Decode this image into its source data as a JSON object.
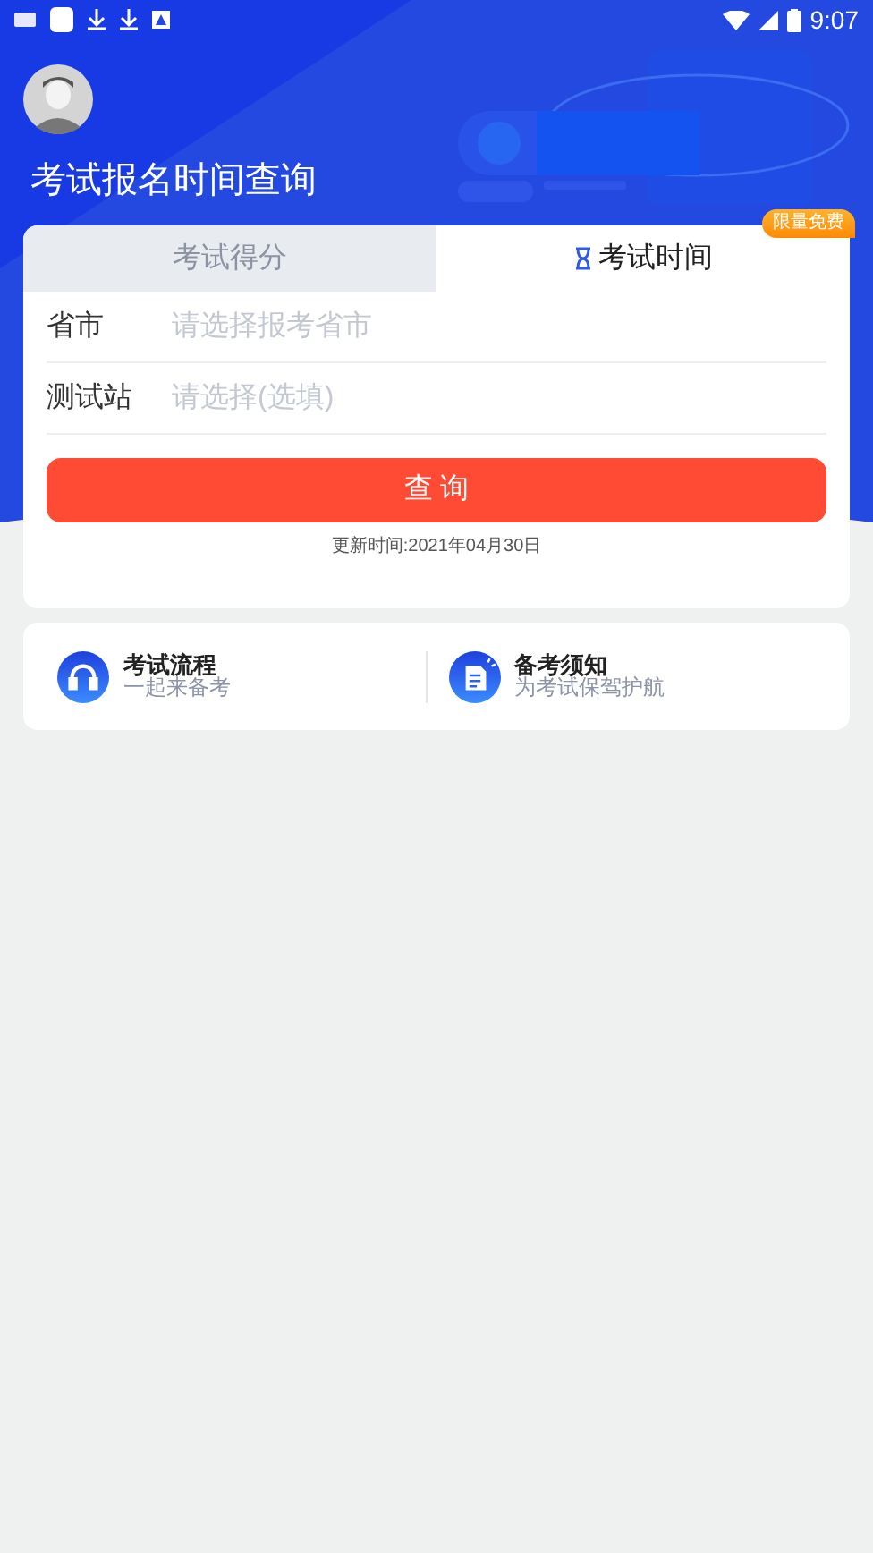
{
  "status_bar": {
    "time": "9:07"
  },
  "header": {
    "title": "考试报名时间查询"
  },
  "tabs": [
    {
      "label": "考试得分",
      "selected": false
    },
    {
      "label": "考试时间",
      "selected": true
    }
  ],
  "badge": "限量免费",
  "form": {
    "fields": [
      {
        "label": "省市",
        "placeholder": "请选择报考省市"
      },
      {
        "label": "测试站",
        "placeholder": "请选择(选填)"
      }
    ],
    "submit": "查 询",
    "updated": "更新时间:2021年04月30日"
  },
  "links": [
    {
      "kind": "headphones",
      "title": "考试流程",
      "subtitle": "一起来备考"
    },
    {
      "kind": "note",
      "title": "备考须知",
      "subtitle": "为考试保驾护航"
    }
  ]
}
